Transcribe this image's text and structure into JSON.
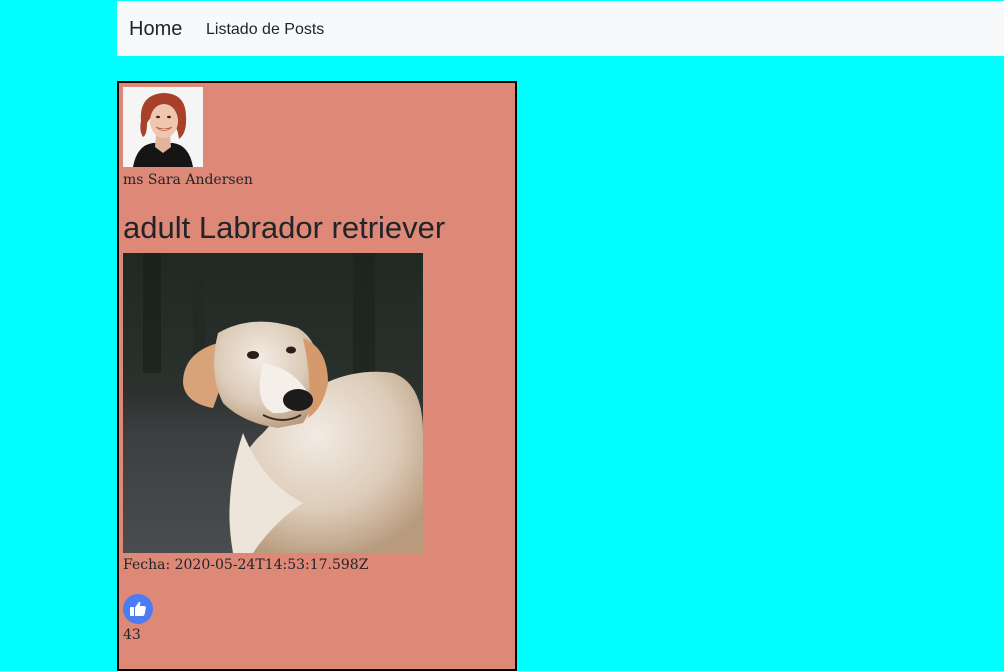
{
  "nav": {
    "brand": "Home",
    "link": "Listado de Posts"
  },
  "post": {
    "author": "ms Sara Andersen",
    "title": "adult Labrador retriever",
    "date": "Fecha: 2020-05-24T14:53:17.598Z",
    "likes": "43"
  },
  "icons": {
    "like": "thumbs-up-icon"
  },
  "colors": {
    "page_background": "#00ffff",
    "navbar_background": "#f8f9fa",
    "card_background": "#de8878",
    "card_border": "#000000",
    "like_button": "#4c7cf3"
  }
}
